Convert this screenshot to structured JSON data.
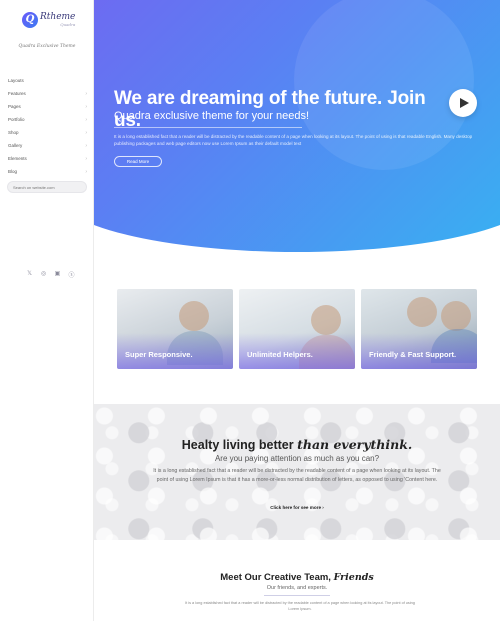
{
  "brand": {
    "name": "Rtheme",
    "sub": "Quadra",
    "tagline": "Quadra Exclusive Theme"
  },
  "sidebar": {
    "items": [
      {
        "label": "Layouts",
        "has_children": false
      },
      {
        "label": "Features",
        "has_children": true
      },
      {
        "label": "Pages",
        "has_children": true
      },
      {
        "label": "Portfolio",
        "has_children": true
      },
      {
        "label": "Shop",
        "has_children": true
      },
      {
        "label": "Gallery",
        "has_children": true
      },
      {
        "label": "Elements",
        "has_children": true
      },
      {
        "label": "Blog",
        "has_children": true
      }
    ],
    "search_placeholder": "Search on website.com",
    "social": [
      {
        "icon": "twitter-icon",
        "glyph": "•"
      },
      {
        "icon": "dribbble-icon",
        "glyph": "◎"
      },
      {
        "icon": "instagram-icon",
        "glyph": "▣"
      },
      {
        "icon": "skype-icon",
        "glyph": "ⓢ"
      }
    ]
  },
  "hero": {
    "title": "We are dreaming of the future. Join us.",
    "subtitle": "Quadra exclusive theme for your needs!",
    "body": "It is a long established fact that a reader will be distracted by the readable content of a page when looking at its layout. The point of using is that readable English. Many desktop publishing packages and web page editors now use Lorem Ipsum as their default model text",
    "button": "Read More"
  },
  "features": [
    {
      "label": "Super Responsive."
    },
    {
      "label": "Unlimited Helpers."
    },
    {
      "label": "Friendly & Fast Support."
    }
  ],
  "healthy": {
    "title_main": "Healty living better ",
    "title_emph": "than everythink.",
    "subtitle": "Are you paying attention as much as you can?",
    "body": "It is a long established fact that a reader will be distracted by the readable content of a page when looking at its layout. The point of using Lorem Ipsum is that it has a more-or-less normal distribution of letters, as opposed to using 'Content here.",
    "link": "Click here for see more ›"
  },
  "team": {
    "title_main": "Meet Our Creative Team, ",
    "title_emph": "Friends",
    "subtitle": "Our friends, and experts.",
    "body": "It is a long established fact that a reader will be distracted by the readable content of a page when looking at its layout. The point of using Lorem Ipsum."
  },
  "colors": {
    "accent": "#6a5af9",
    "gradient_end": "#35b5f2"
  }
}
